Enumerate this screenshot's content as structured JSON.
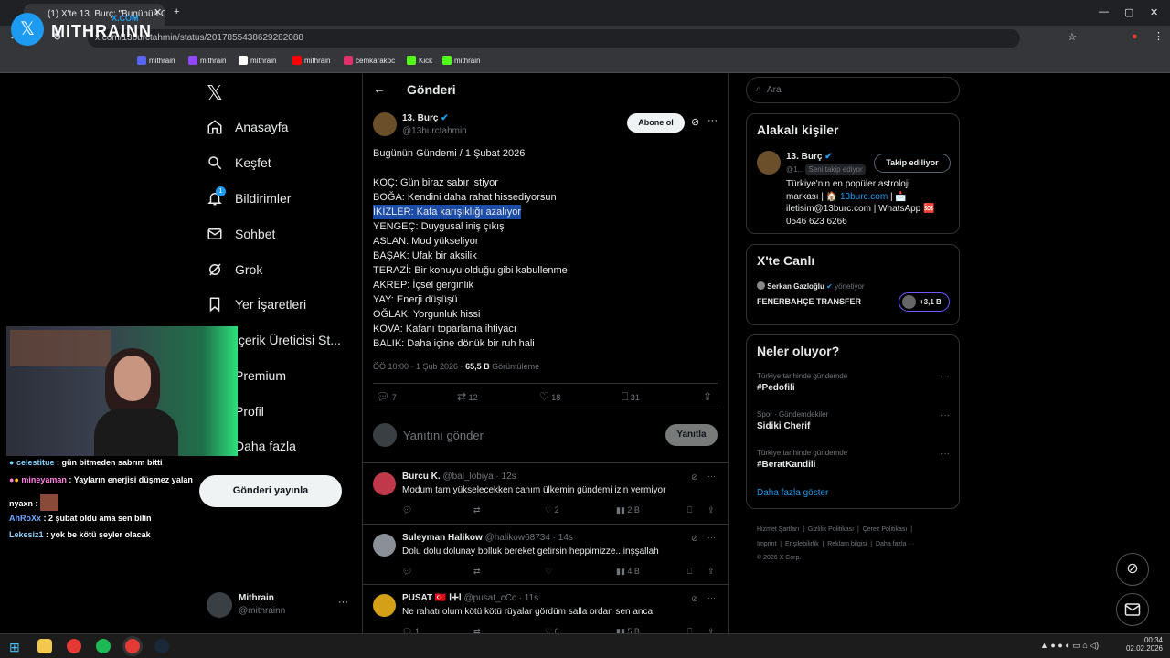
{
  "browser": {
    "tab_title": "(1) X'te 13. Burç: \"Bugünün Gün",
    "url": "x.com/13burctahmin/status/2017855438629282088",
    "bookmarks": [
      "mithrain",
      "mithrain",
      "mithrain",
      "mithrain",
      "cemkarakoc",
      "Kick",
      "mithrain"
    ],
    "bookmark_colors": [
      "#5865f2",
      "#9146ff",
      "#ffffff",
      "#ff0000",
      "#e1306c",
      "#53fc18",
      "#53fc18"
    ]
  },
  "overlay": {
    "brand": "MITHRAINN",
    "brand_sub": "X.COM"
  },
  "nav": {
    "items": [
      "Anasayfa",
      "Keşfet",
      "Bildirimler",
      "Sohbet",
      "Grok",
      "Yer İşaretleri",
      "İçerik Üreticisi St...",
      "Premium",
      "Profil",
      "Daha fazla"
    ],
    "notif_count": "1",
    "post_button": "Gönderi yayınla",
    "account_name": "Mithrain",
    "account_handle": "@mithrainn"
  },
  "post": {
    "header": "Gönderi",
    "author_name": "13. Burç",
    "author_handle": "@13burctahmin",
    "subscribe": "Abone ol",
    "title": "Bugünün Gündemi / 1 Şubat 2026",
    "lines": [
      "KOÇ: Gün biraz sabır istiyor",
      "BOĞA: Kendini daha rahat hissediyorsun",
      "İKİZLER: Kafa karışıklığı azalıyor",
      "YENGEÇ: Duygusal iniş çıkış",
      "ASLAN: Mod yükseliyor",
      "BAŞAK: Ufak bir aksilik",
      "TERAZİ: Bir konuyu olduğu gibi kabullenme",
      "AKREP: İçsel gerginlik",
      "YAY: Enerji düşüşü",
      "OĞLAK: Yorgunluk hissi",
      "KOVA: Kafanı toparlama ihtiyacı",
      "BALIK: Daha içine dönük bir ruh hali"
    ],
    "time": "ÖÖ 10:00 · 1 Şub 2026 · ",
    "views": "65,5 B",
    "views_label": "Görüntüleme",
    "replies": "7",
    "reposts": "12",
    "likes": "18",
    "bookmarks": "31",
    "reply_placeholder": "Yanıtını gönder",
    "reply_button": "Yanıtla"
  },
  "replies": [
    {
      "name": "Burcu K.",
      "handle": "@bal_lobiya · 12s",
      "text": "Modum tam yükselecekken canım ülkemin gündemi izin vermiyor",
      "replies": "",
      "reposts": "",
      "likes": "2",
      "views": "2 B",
      "avatar": "#c0394b"
    },
    {
      "name": "Suleyman Halikow",
      "handle": "@halikow68734 · 14s",
      "text": "Dolu dolu dolunay bolluk bereket getirsin heppimizze...inşşallah",
      "replies": "",
      "reposts": "",
      "likes": "",
      "views": "4 B",
      "avatar": "#8a8f98"
    },
    {
      "name": "PUSAT 🇹🇷 ⵏⵜⵏ",
      "handle": "@pusat_cCc · 11s",
      "text": "Ne rahatı olum kötü kötü rüyalar gördüm salla ordan sen anca",
      "replies": "1",
      "reposts": "",
      "likes": "6",
      "views": "5 B",
      "avatar": "#d4a017"
    }
  ],
  "right": {
    "search_placeholder": "Ara",
    "related_title": "Alakalı kişiler",
    "person_name": "13. Burç",
    "person_handle": "@1...",
    "follows_you": "Seni takip ediyor",
    "following_button": "Takip ediliyor",
    "bio_1": "Türkiye'nin en popüler astroloji",
    "bio_2a": "markası | 🏠 ",
    "bio_link": "13burc.com",
    "bio_2b": " | 📩",
    "bio_3": "iletisim@13burc.com | WhatsApp 🆘",
    "bio_4": "0546 623 6266",
    "live_title": "X'te Canlı",
    "live_host": "Serkan Gazloğlu",
    "live_host_status": "yönetiyor",
    "live_topic": "FENERBAHÇE TRANSFER",
    "live_count": "+3,1 B",
    "trends_title": "Neler oluyor?",
    "trends": [
      {
        "context": "Türkiye tarihinde gündemde",
        "name": "#Pedofili"
      },
      {
        "context": "Spor · Gündemdekiler",
        "name": "Sidiki Cherif"
      },
      {
        "context": "Türkiye tarihinde gündemde",
        "name": "#BeratKandili"
      }
    ],
    "show_more": "Daha fazla göster",
    "footer_1": [
      "Hizmet Şartları",
      "|",
      "Gizlilik Politikası",
      "|",
      "Çerez Politikası",
      "|"
    ],
    "footer_2": [
      "Imprint",
      "|",
      "Erişilebilirlik",
      "|",
      "Reklam bilgisi",
      "|",
      "Daha fazla ···"
    ],
    "footer_3": "© 2026 X Corp."
  },
  "stream_chat": [
    {
      "user": "celestitue",
      "msg": " : gün bitmeden sabrım bitti",
      "color": "#7fd1ff"
    },
    {
      "user": "mineyaman",
      "msg": " : Yayların enerjisi düşmez yalan",
      "color": "#ff7fe0"
    },
    {
      "user": "nyaxn",
      "msg": " : ",
      "color": "#ffffff"
    },
    {
      "user": "AhRoXx",
      "msg": " : 2 şubat oldu ama sen bilin",
      "color": "#6fa8ff"
    },
    {
      "user": "Lekesiz1",
      "msg": " : yok be kötü şeyler olacak",
      "color": "#8fd1ff"
    }
  ],
  "taskbar": {
    "time": "00:34",
    "date": "02.02.2026"
  }
}
